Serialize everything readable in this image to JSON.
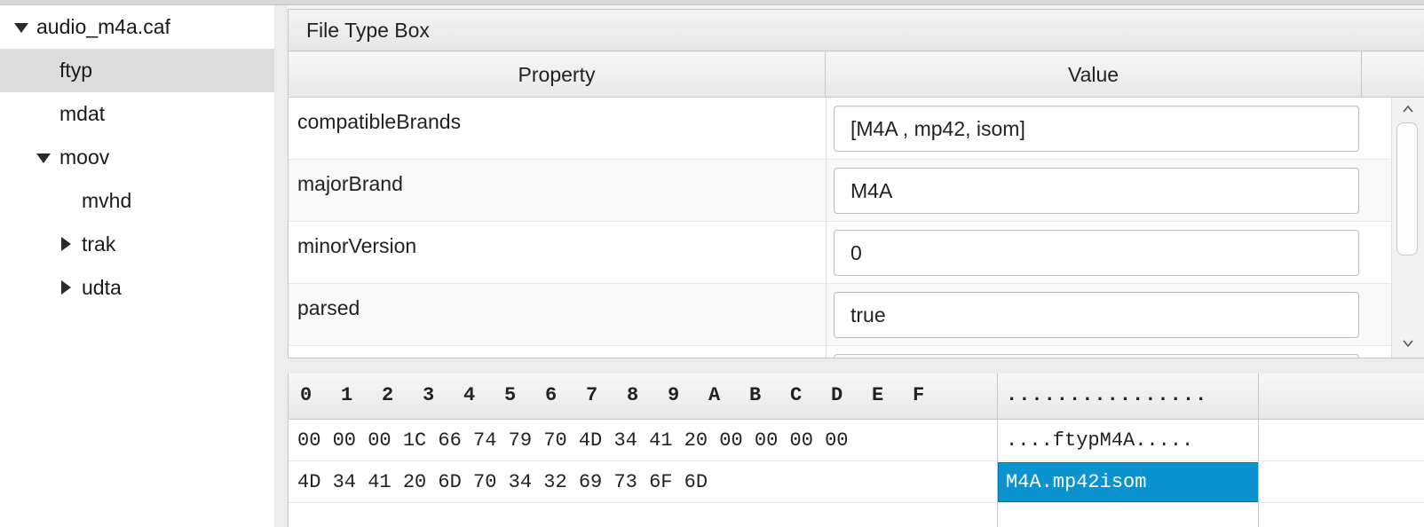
{
  "tree": {
    "items": [
      {
        "label": "audio_m4a.caf",
        "expanded": true,
        "selected": false
      },
      {
        "label": "ftyp",
        "selected": true
      },
      {
        "label": "mdat",
        "selected": false
      },
      {
        "label": "moov",
        "expanded": true,
        "selected": false
      },
      {
        "label": "mvhd",
        "selected": false
      },
      {
        "label": "trak",
        "expanded": false,
        "selected": false
      },
      {
        "label": "udta",
        "expanded": false,
        "selected": false
      }
    ]
  },
  "section": {
    "title": "File Type Box"
  },
  "table": {
    "headers": {
      "property": "Property",
      "value": "Value"
    },
    "rows": [
      {
        "property": "compatibleBrands",
        "value": "[M4A , mp42, isom]"
      },
      {
        "property": "majorBrand",
        "value": "M4A"
      },
      {
        "property": "minorVersion",
        "value": "0"
      },
      {
        "property": "parsed",
        "value": "true"
      }
    ]
  },
  "hex": {
    "columns": [
      "0",
      "1",
      "2",
      "3",
      "4",
      "5",
      "6",
      "7",
      "8",
      "9",
      "A",
      "B",
      "C",
      "D",
      "E",
      "F"
    ],
    "ascii_header": "................",
    "rows": [
      {
        "bytes": "00 00 00 1C 66 74 79 70 4D 34 41 20 00 00 00 00",
        "ascii": "....ftypM4A....."
      },
      {
        "bytes": "4D 34 41 20 6D 70 34 32 69 73 6F 6D",
        "ascii": "M4A.mp42isom"
      }
    ]
  },
  "colors": {
    "selection": "#0a93d0",
    "tree_selected": "#dcdcdc"
  }
}
